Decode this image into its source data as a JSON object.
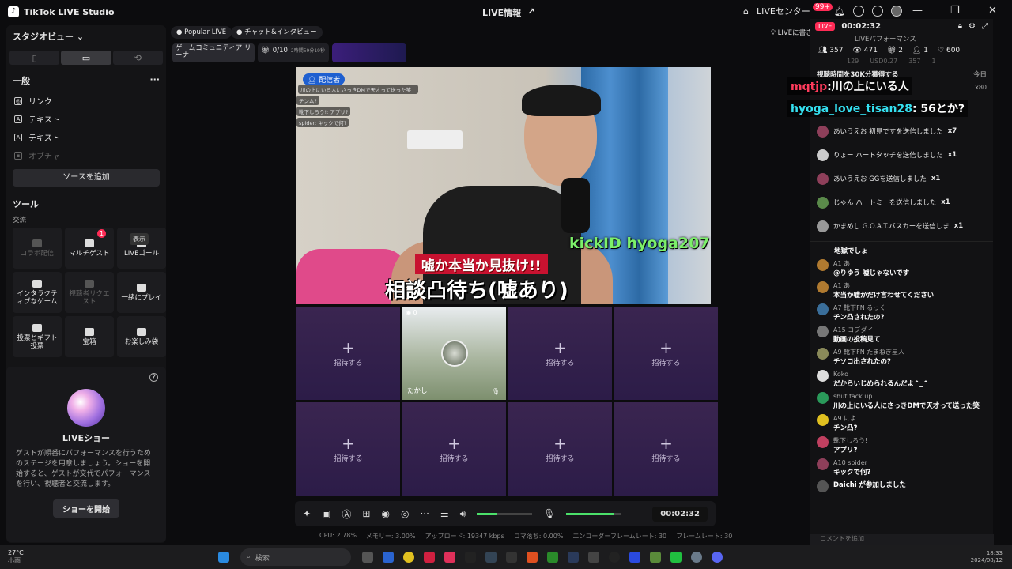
{
  "app": {
    "title": "TikTok LIVE Studio",
    "center_title": "LIVE情報",
    "live_center": "LIVEセンター",
    "notif_badge": "99+"
  },
  "sidebar": {
    "studio_view": "スタジオビュー",
    "general": "一般",
    "sources": [
      {
        "label": "リンク"
      },
      {
        "label": "テキスト"
      },
      {
        "label": "テキスト"
      },
      {
        "label": "オブチャ"
      }
    ],
    "add_source": "ソースを追加",
    "tools_title": "ツール",
    "interaction": "交流",
    "tooltip": "表示",
    "tools": [
      {
        "label": "コラボ配信",
        "disabled": true
      },
      {
        "label": "マルチゲスト",
        "badge": "1"
      },
      {
        "label": "LIVEゴール"
      },
      {
        "label": "インタラクテ ィブなゲーム"
      },
      {
        "label": "視聴者リクエ スト",
        "disabled": true
      },
      {
        "label": "一緒にプレイ"
      },
      {
        "label": "投票とギフト 投票"
      },
      {
        "label": "宝箱"
      },
      {
        "label": "お楽しみ袋"
      }
    ],
    "liveshow": {
      "title": "LIVEショー",
      "desc": "ゲストが順番にパフォーマンスを行うためのステージを用意しましょう。ショーを開始すると、ゲストが交代でパフォーマンスを行い、視聴者と交流します。",
      "button": "ショーを開始"
    }
  },
  "top": {
    "pill1": "Popular LIVE",
    "pill2": "チャット&インタビュー",
    "card1": "ゲームコミュニティア リーナ",
    "card2_count": "0/10",
    "card2_time": "2時間59分19秒",
    "hint": "LIVEに書き込みを追加"
  },
  "video": {
    "host_badge": "配信者",
    "kick": "kickID hyoga207",
    "red_caption": "嘘か本当か見抜け!!",
    "big_caption": "相談凸待ち(嘘あり)",
    "overlay_msgs": [
      "川の上にいる人にさっきDMで天才って送った笑",
      "チンム?",
      "靴下しろう!: アプリ?",
      "spider: キックで何?"
    ]
  },
  "grid": {
    "invite": "招待する",
    "guest_name": "たかし",
    "guest_count": "0"
  },
  "controls": {
    "timer": "00:02:32"
  },
  "stats": {
    "cpu": "CPU: 2.78%",
    "memory": "メモリー: 3.00%",
    "upload": "アップロード: 19347 kbps",
    "drop": "コマ落ち: 0.00%",
    "encoder": "エンコーダーフレームレート: 30",
    "framerate": "フレームレート: 30"
  },
  "right": {
    "live": "LIVE",
    "time": "00:02:32",
    "perf": "LIVEパフォーマンス",
    "stats": [
      "357",
      "471",
      "2",
      "1",
      "600"
    ],
    "sub_stats": [
      "129",
      "USD0.27",
      "357",
      "1"
    ],
    "goal": "視聴時間を30K分獲得する",
    "today": "今日",
    "x80": "x80",
    "gifts": [
      {
        "text": "あいうえお 初見ですを送信しました",
        "mult": "x7"
      },
      {
        "text": "りょー ハートタッチを送信しました",
        "mult": "x1"
      },
      {
        "text": "あいうえお GGを送信しました",
        "mult": "x1"
      },
      {
        "text": "じゃん ハートミーを送信しました",
        "mult": "x1"
      },
      {
        "text": "かまめし G.O.A.T.バスカーを送信しま",
        "mult": "x1"
      }
    ],
    "comments": [
      {
        "name": "",
        "text": "地獄でしょ"
      },
      {
        "name": "A1 あ",
        "text": "@りゆう 嘘じゃないです"
      },
      {
        "name": "A1 あ",
        "text": "本当か嘘かだけ言わせてください"
      },
      {
        "name": "A7 靴下FN るっく",
        "text": "チン凸されたの?"
      },
      {
        "name": "A15 コブダイ",
        "text": "動画の投稿見て"
      },
      {
        "name": "A9 靴下FN たまねぎ星人",
        "text": "チソコ出されたの?"
      },
      {
        "name": "Koko",
        "text": "だからいじめられるんだよ^_^"
      },
      {
        "name": "shut fack up",
        "text": "川の上にいる人にさっきDMで天才って送った笑"
      },
      {
        "name": "A9 によ",
        "text": "チン凸?"
      },
      {
        "name": "靴下しろう!",
        "text": "アプリ?"
      },
      {
        "name": "A10 spider",
        "text": "キックで何?"
      },
      {
        "name": "Daichi",
        "text": "が参加しました"
      }
    ],
    "comment_placeholder": "コメントを追加"
  },
  "floating": [
    {
      "name": "mqtjp",
      "text": ":川の上にいる人"
    },
    {
      "name": "hyoga_love_tisan28",
      "text": ": 56とか?"
    }
  ],
  "taskbar": {
    "weather": "27°C",
    "weather_sub": "小雨",
    "search": "検索",
    "clock_time": "18:33",
    "clock_date": "2024/08/12"
  }
}
